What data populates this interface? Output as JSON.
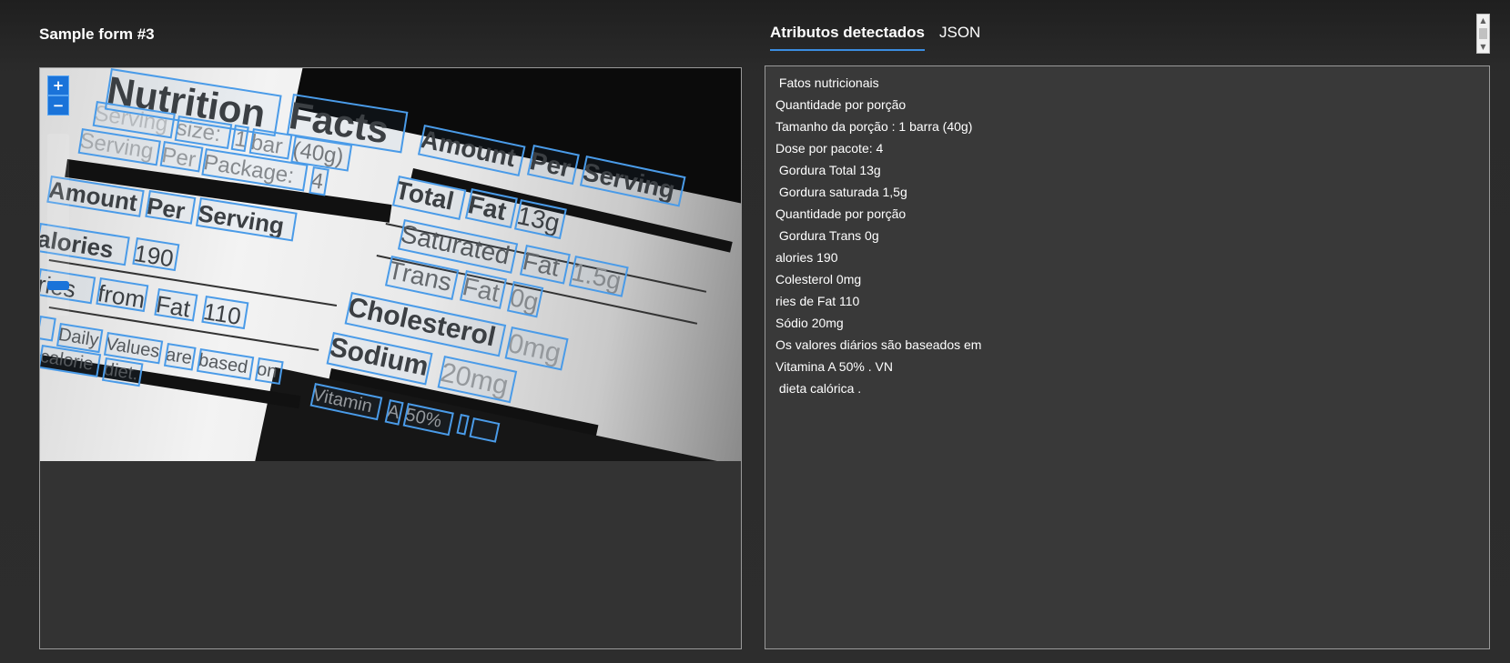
{
  "form_title": "Sample form #3",
  "tabs": [
    {
      "label": "Atributos detectados",
      "active": true
    },
    {
      "label": "JSON",
      "active": false
    }
  ],
  "zoom": {
    "in_label": "+",
    "out_label": "−",
    "level": 0.15
  },
  "accent_color": "#1a73d9",
  "box_color": "#4a9be8",
  "detected_lines": [
    " Fatos nutricionais",
    "Quantidade por porção",
    "Tamanho da porção : 1 barra (40g)",
    "Dose por pacote: 4",
    " Gordura Total 13g",
    " Gordura saturada 1,5g",
    "Quantidade por porção",
    " Gordura Trans 0g",
    "alories 190",
    "Colesterol 0mg",
    "ries de Fat 110",
    "Sódio 20mg",
    "Os valores diários são baseados em",
    "Vitamina A 50% . VN",
    " dieta calórica ."
  ],
  "image_words": {
    "nutrition": "Nutrition",
    "facts": "Facts",
    "serving": "Serving",
    "size": "size:",
    "one": "1",
    "bar": "bar",
    "forty": "(40g)",
    "serving2": "Serving",
    "per": "Per",
    "package": "Package:",
    "four": "4",
    "amount": "Amount",
    "per2": "Per",
    "serving3": "Serving",
    "alories": "alories",
    "one90": "190",
    "ries": "ries",
    "from": "from",
    "fat": "Fat",
    "one10": "110",
    "daily": "Daily",
    "values": "Values",
    "are": "are",
    "based": "based",
    "on": "on",
    "calorie": "calorie",
    "diet": "diet.",
    "amount2": "Amount",
    "per3": "Per",
    "serving4": "Serving",
    "total": "Total",
    "fat2": "Fat",
    "thirteen": "13g",
    "saturated": "Saturated",
    "fat3": "Fat",
    "onefive": "1.5g",
    "trans": "Trans",
    "fat4": "Fat",
    "zero": "0g",
    "cholesterol": "Cholesterol",
    "zeromg": "0mg",
    "sodium": "Sodium",
    "twentymg": "20mg",
    "vitamin": "Vitamin",
    "a": "A",
    "fifty": "50%"
  }
}
